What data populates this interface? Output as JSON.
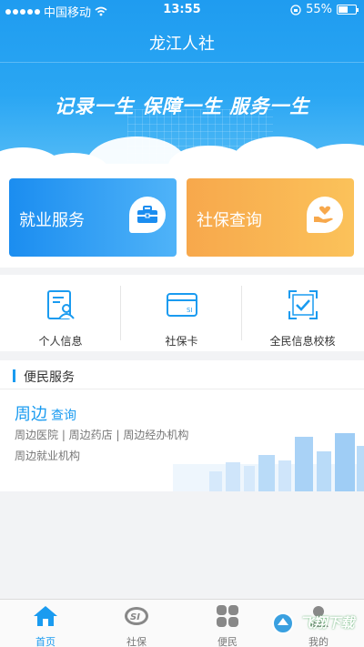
{
  "status_bar": {
    "carrier": "中国移动",
    "time": "13:55",
    "battery": "55%",
    "battery_level": 0.55
  },
  "app": {
    "title": "龙江人社",
    "slogan": "记录一生  保障一生  服务一生"
  },
  "cards": [
    {
      "label": "就业服务",
      "icon": "briefcase-icon",
      "color": "#1b8df0"
    },
    {
      "label": "社保查询",
      "icon": "hand-heart-icon",
      "color": "#f7a84c"
    }
  ],
  "functions": [
    {
      "label": "个人信息",
      "icon": "person-document-icon"
    },
    {
      "label": "社保卡",
      "icon": "si-card-icon",
      "card_text": "SI"
    },
    {
      "label": "全民信息校核",
      "icon": "verify-icon"
    }
  ],
  "convenience": {
    "title": "便民服务",
    "nearby": "周边",
    "query": "查询",
    "links_line1": "周边医院 | 周边药店 | 周边经办机构",
    "links_line2": "周边就业机构"
  },
  "tabbar": [
    {
      "label": "首页",
      "icon": "home-icon",
      "active": true
    },
    {
      "label": "社保",
      "icon": "si-logo-icon",
      "icon_text": "SI",
      "active": false
    },
    {
      "label": "便民",
      "icon": "grid-icon",
      "active": false
    },
    {
      "label": "我的",
      "icon": "person-icon",
      "active": false
    }
  ],
  "watermark": "飞翔下载",
  "colors": {
    "primary": "#1a9bf0",
    "orange": "#f7a84c"
  }
}
